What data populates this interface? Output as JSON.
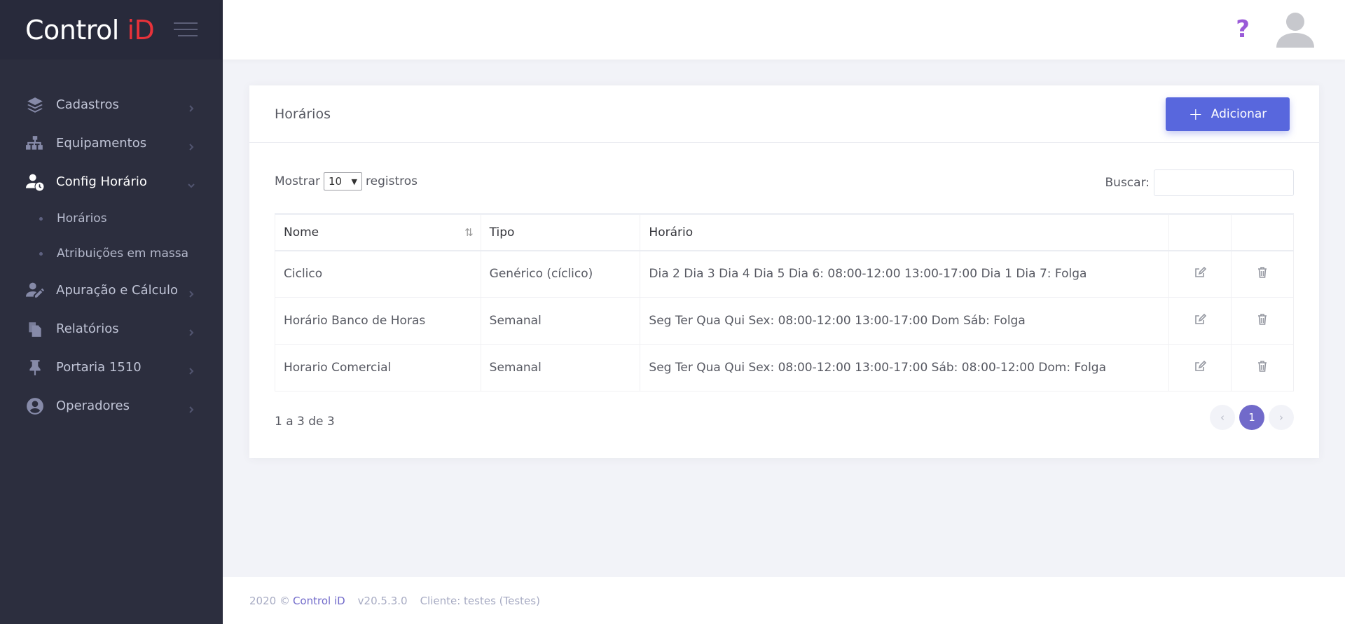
{
  "brand": {
    "logo_main": "Control ",
    "logo_accent": "iD"
  },
  "sidebar": {
    "items": [
      {
        "label": "Cadastros",
        "icon": "layers-icon"
      },
      {
        "label": "Equipamentos",
        "icon": "sitemap-icon"
      },
      {
        "label": "Config Horário",
        "icon": "user-clock-icon",
        "expanded": true,
        "children": [
          {
            "label": "Horários"
          },
          {
            "label": "Atribuições em massa"
          }
        ]
      },
      {
        "label": "Apuração e Cálculo",
        "icon": "user-edit-icon"
      },
      {
        "label": "Relatórios",
        "icon": "copy-icon"
      },
      {
        "label": "Portaria 1510",
        "icon": "pin-icon"
      },
      {
        "label": "Operadores",
        "icon": "user-circle-icon"
      }
    ]
  },
  "header": {
    "help_symbol": "?"
  },
  "page": {
    "title": "Horários",
    "add_label": "Adicionar",
    "show_label": "Mostrar",
    "page_size": "10",
    "records_label": "registros",
    "search_label": "Buscar:",
    "search_value": ""
  },
  "table": {
    "headers": [
      "Nome",
      "Tipo",
      "Horário"
    ],
    "rows": [
      {
        "nome": "Ciclico",
        "tipo": "Genérico (cíclico)",
        "horario": "Dia 2 Dia 3 Dia 4 Dia 5 Dia 6: 08:00-12:00 13:00-17:00 Dia 1 Dia 7: Folga"
      },
      {
        "nome": "Horário Banco de Horas",
        "tipo": "Semanal",
        "horario": "Seg Ter Qua Qui Sex: 08:00-12:00 13:00-17:00 Dom Sáb: Folga"
      },
      {
        "nome": "Horario Comercial",
        "tipo": "Semanal",
        "horario": "Seg Ter Qua Qui Sex: 08:00-12:00 13:00-17:00 Sáb: 08:00-12:00 Dom: Folga"
      }
    ]
  },
  "pagination": {
    "info": "1 a 3 de 3",
    "prev": "‹",
    "current": "1",
    "next": "›"
  },
  "footer": {
    "year": "2020 ©",
    "brand": "Control iD",
    "version": "v20.5.3.0",
    "client": "Cliente: testes (Testes)"
  },
  "colors": {
    "sidebar": "#2c2e3e",
    "accent": "#5867dd",
    "logo_red": "#e8323a",
    "page_active": "#716aca"
  }
}
